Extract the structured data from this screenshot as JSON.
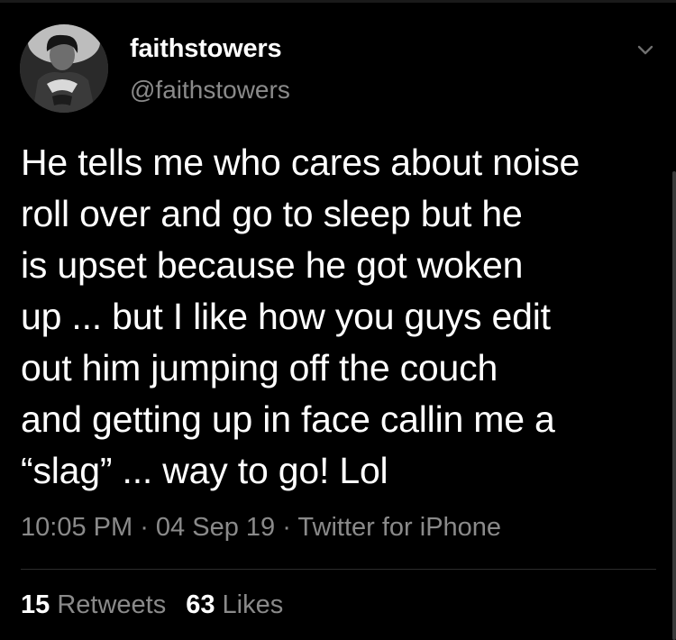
{
  "tweet": {
    "display_name": "faithstowers",
    "handle": "@faithstowers",
    "text": "He tells me who cares about noise\nroll over and go to sleep but he\nis upset because he got woken\nup ... but I like how you guys edit\nout him jumping off the couch\nand getting up in face callin me a\n“slag” ... way to go! Lol",
    "time": "10:05 PM",
    "date": "04 Sep 19",
    "source": "Twitter for iPhone",
    "separator": " · ",
    "retweets_count": "15",
    "retweets_label": "Retweets",
    "likes_count": "63",
    "likes_label": "Likes"
  },
  "icons": {
    "menu": "chevron-down-icon"
  },
  "colors": {
    "background": "#000000",
    "primary_text": "#ffffff",
    "secondary_text": "#8a8a8a",
    "divider": "#2c2c2c"
  }
}
